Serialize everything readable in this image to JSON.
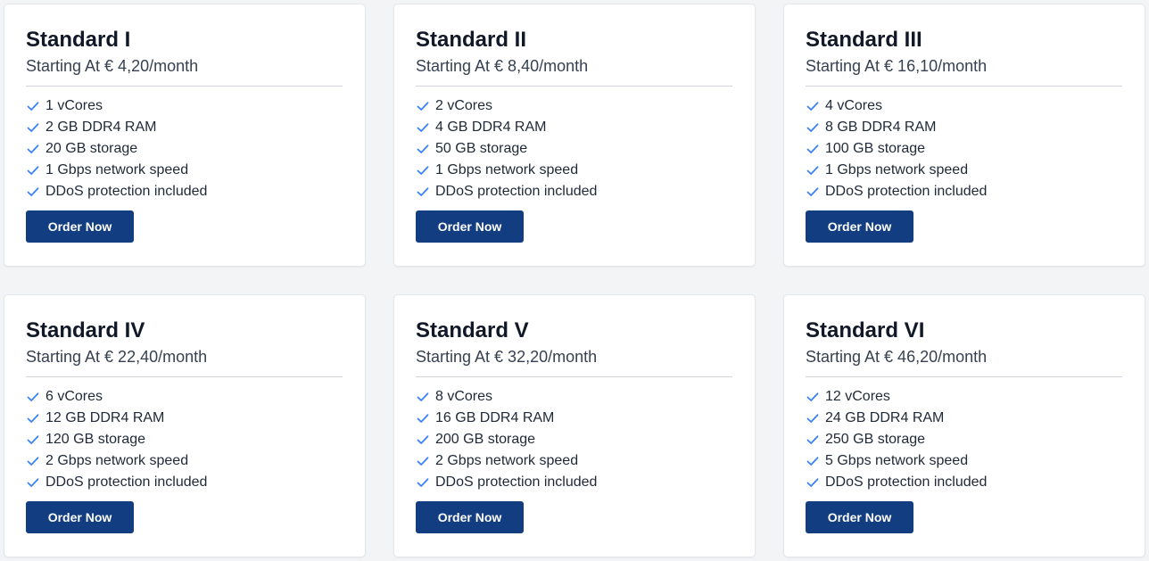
{
  "plans": [
    {
      "name": "Standard I",
      "price": "Starting At € 4,20/month",
      "features": [
        "1 vCores",
        "2 GB DDR4 RAM",
        "20 GB storage",
        "1 Gbps network speed",
        "DDoS protection included"
      ],
      "button": "Order Now"
    },
    {
      "name": "Standard II",
      "price": "Starting At € 8,40/month",
      "features": [
        "2 vCores",
        "4 GB DDR4 RAM",
        "50 GB storage",
        "1 Gbps network speed",
        "DDoS protection included"
      ],
      "button": "Order Now"
    },
    {
      "name": "Standard III",
      "price": "Starting At € 16,10/month",
      "features": [
        "4 vCores",
        "8 GB DDR4 RAM",
        "100 GB storage",
        "1 Gbps network speed",
        "DDoS protection included"
      ],
      "button": "Order Now"
    },
    {
      "name": "Standard IV",
      "price": "Starting At € 22,40/month",
      "features": [
        "6 vCores",
        "12 GB DDR4 RAM",
        "120 GB storage",
        "2 Gbps network speed",
        "DDoS protection included"
      ],
      "button": "Order Now"
    },
    {
      "name": "Standard V",
      "price": "Starting At € 32,20/month",
      "features": [
        "8 vCores",
        "16 GB DDR4 RAM",
        "200 GB storage",
        "2 Gbps network speed",
        "DDoS protection included"
      ],
      "button": "Order Now"
    },
    {
      "name": "Standard VI",
      "price": "Starting At € 46,20/month",
      "features": [
        "12 vCores",
        "24 GB DDR4 RAM",
        "250 GB storage",
        "5 Gbps network speed",
        "DDoS protection included"
      ],
      "button": "Order Now"
    }
  ],
  "icons": {
    "feature": "check-icon"
  },
  "colors": {
    "button_bg": "#123d80",
    "check": "#3b82f6",
    "page_bg": "#f3f4f6"
  }
}
